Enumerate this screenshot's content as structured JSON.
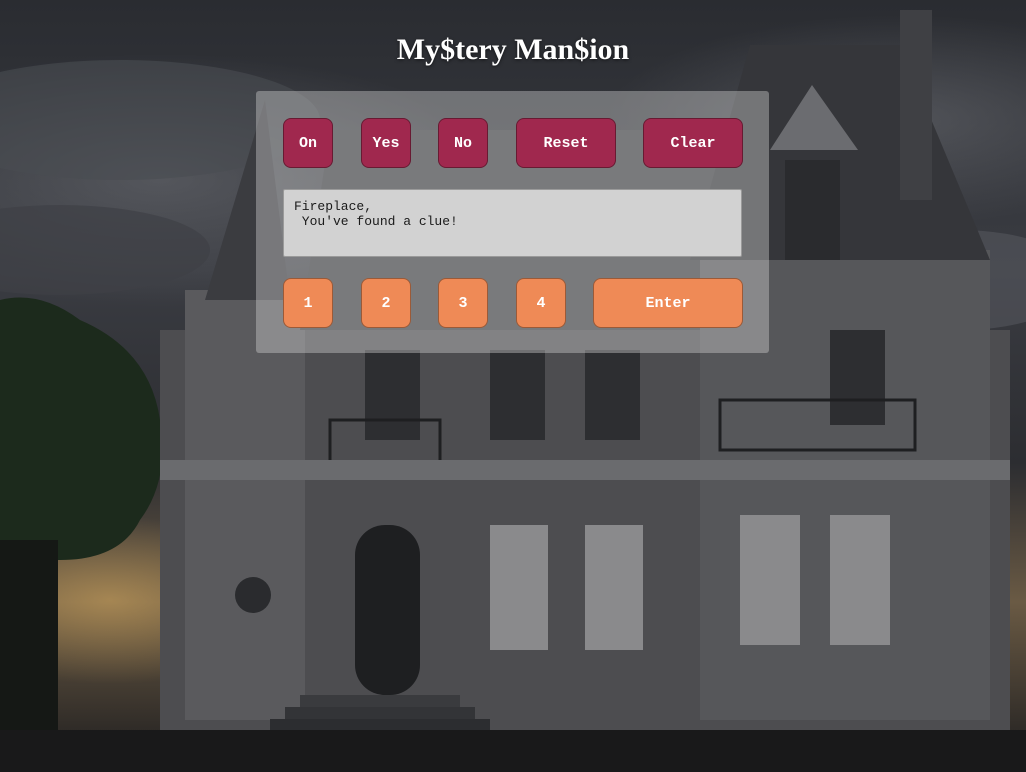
{
  "app": {
    "title": "My$tery Man$ion"
  },
  "controls": {
    "on_label": "On",
    "yes_label": "Yes",
    "no_label": "No",
    "reset_label": "Reset",
    "clear_label": "Clear"
  },
  "display": {
    "text": "Fireplace,\n You've found a clue!"
  },
  "keypad": {
    "keys": [
      "1",
      "2",
      "3",
      "4"
    ],
    "enter_label": "Enter"
  },
  "colors": {
    "control_button": "#a0284e",
    "keypad_button": "#ef8a56",
    "panel": "rgba(205,205,205,0.42)",
    "display_bg": "#d2d2d2"
  },
  "background": {
    "icon": "haunted-mansion-image"
  }
}
